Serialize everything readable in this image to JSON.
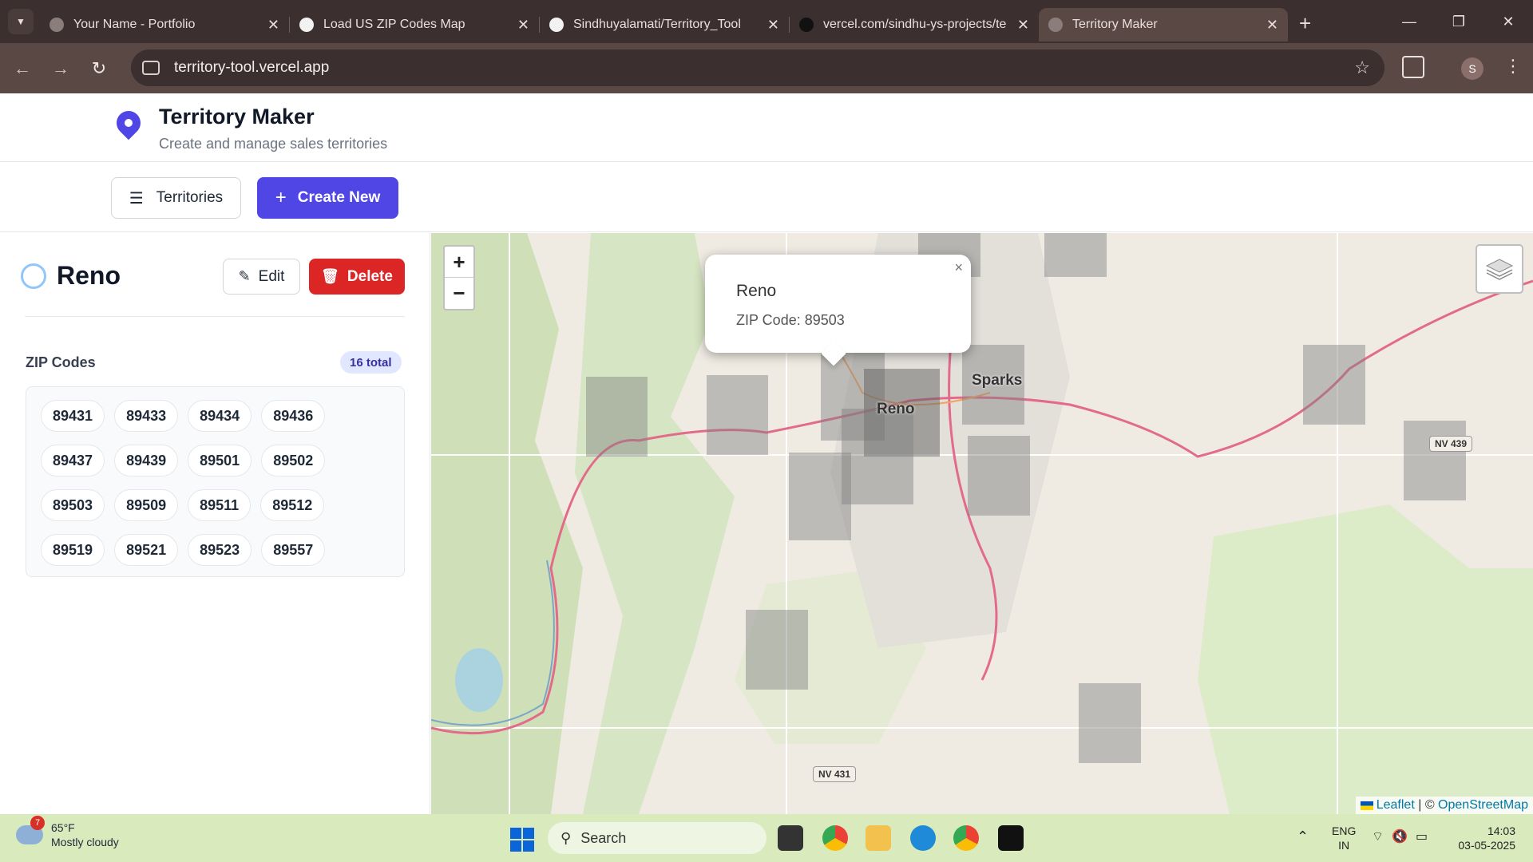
{
  "browser": {
    "tabs": [
      {
        "title": "Your Name - Portfolio"
      },
      {
        "title": "Load US ZIP Codes Map"
      },
      {
        "title": "Sindhuyalamati/Territory_Tool"
      },
      {
        "title": "vercel.com/sindhu-ys-projects/te"
      },
      {
        "title": "Territory Maker"
      }
    ],
    "active_tab": 4,
    "url": "territory-tool.vercel.app",
    "profile_initial": "S"
  },
  "app": {
    "title": "Territory Maker",
    "subtitle": "Create and manage sales territories",
    "accent_color": "#4f46e5",
    "toolbar": {
      "territories_label": "Territories",
      "create_label": "Create New"
    }
  },
  "territory": {
    "name": "Reno",
    "edit_label": "Edit",
    "delete_label": "Delete",
    "zip_heading": "ZIP Codes",
    "zip_count": "16 total",
    "zips": [
      "89431",
      "89433",
      "89434",
      "89436",
      "89437",
      "89439",
      "89501",
      "89502",
      "89503",
      "89509",
      "89511",
      "89512",
      "89519",
      "89521",
      "89523",
      "89557"
    ]
  },
  "map": {
    "zoom_in": "+",
    "zoom_out": "−",
    "popup": {
      "title": "Reno",
      "zip_text": "ZIP Code: 89503",
      "close": "×"
    },
    "labels": {
      "sparks": "Sparks",
      "reno": "Reno",
      "nv439": "NV 439",
      "nv431": "NV 431"
    },
    "attribution": {
      "leaflet": "Leaflet",
      "separator": " | © ",
      "osm": "OpenStreetMap"
    }
  },
  "taskbar": {
    "weather_badge": "7",
    "temperature": "65°F",
    "condition": "Mostly cloudy",
    "search_placeholder": "Search",
    "lang_top": "ENG",
    "lang_bottom": "IN",
    "time": "14:03",
    "date": "03-05-2025"
  }
}
